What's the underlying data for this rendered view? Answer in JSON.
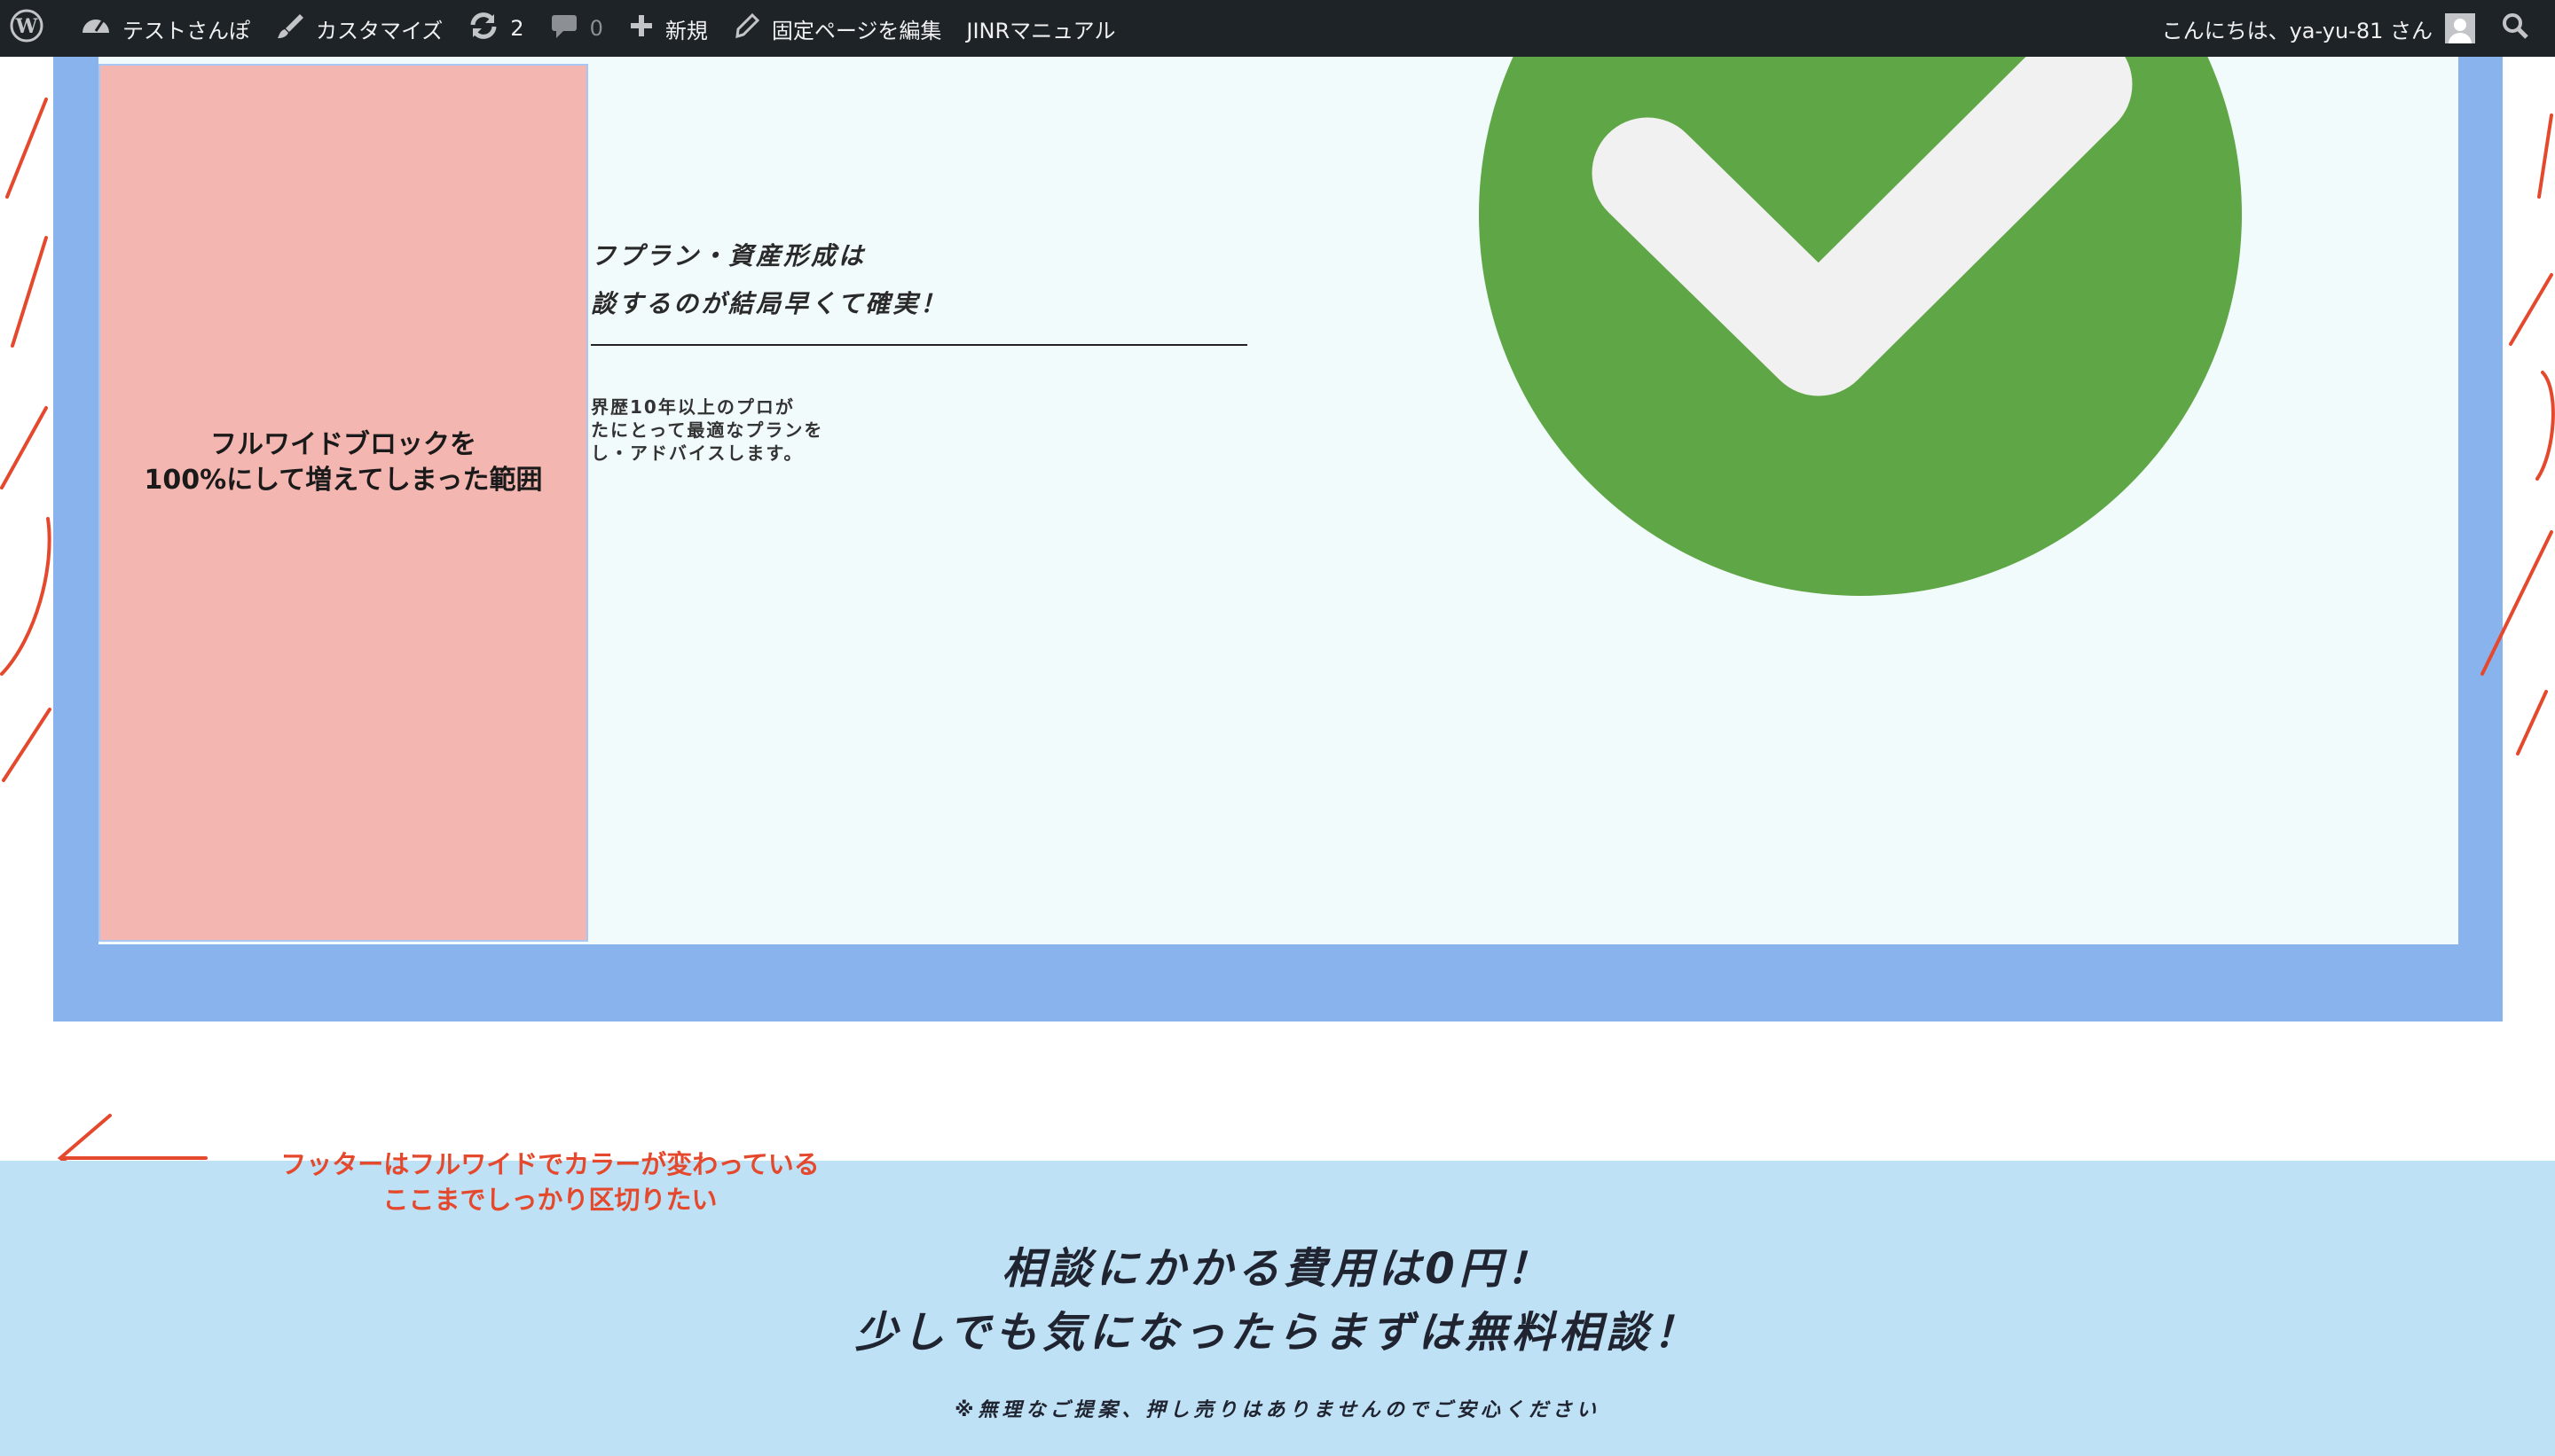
{
  "adminbar": {
    "site_name": "テストさんぽ",
    "customize": "カスタマイズ",
    "updates_count": "2",
    "comments_count": "0",
    "new_label": "新規",
    "edit_page": "固定ページを編集",
    "manual": "JINRマニュアル",
    "greeting": "こんにちは、ya-yu-81 さん"
  },
  "content": {
    "pink_box_lines": [
      "フルワイドブロックを",
      "100%にして増えてしまった範囲"
    ],
    "catch_lines": [
      "フプラン・資産形成は",
      "談するのが結局早くて確実！"
    ],
    "desc_lines": [
      "界歴10年以上のプロが",
      "たにとって最適なプランを",
      "し・アドバイスします。"
    ]
  },
  "annotation": {
    "footer_note_lines": [
      "フッターはフルワイドでカラーが変わっている",
      "ここまでしっかり区切りたい"
    ]
  },
  "footer": {
    "cta_lines": [
      "相談にかかる費用は0円！",
      "少しでも気になったらまずは無料相談！"
    ],
    "note": "※無理なご提案、押し売りはありませんのでご安心ください"
  },
  "colors": {
    "adminbar_bg": "#1d2327",
    "block_blue": "#88b3ec",
    "panel_bg": "#f2fbfb",
    "pink": "#f4b6b1",
    "check_green": "#5fa646",
    "footer_bg": "#bfe1f6",
    "annotation_red": "#e5492d"
  }
}
